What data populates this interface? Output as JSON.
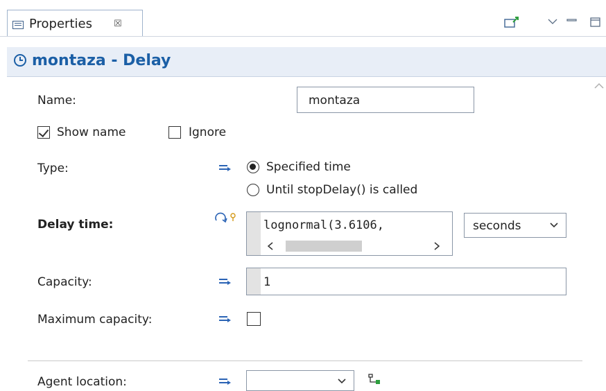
{
  "view": {
    "tab_label": "Properties",
    "tab_close": "☒"
  },
  "header": {
    "title": "montaza - Delay"
  },
  "form": {
    "name_label": "Name:",
    "name_value": "montaza",
    "show_name_label": "Show name",
    "show_name_checked": true,
    "ignore_label": "Ignore",
    "ignore_checked": false,
    "type_label": "Type:",
    "type_options": [
      "Specified time",
      "Until stopDelay() is called"
    ],
    "type_selected": "Specified time",
    "delay_time_label": "Delay time:",
    "delay_time_value": "lognormal(3.6106,",
    "delay_units": "seconds",
    "capacity_label": "Capacity:",
    "capacity_value": "1",
    "max_capacity_label": "Maximum capacity:",
    "max_capacity_checked": false,
    "agent_location_label": "Agent location:",
    "agent_location_value": ""
  },
  "colors": {
    "accent": "#1b5fa6",
    "header_bg": "#e8eef7"
  }
}
